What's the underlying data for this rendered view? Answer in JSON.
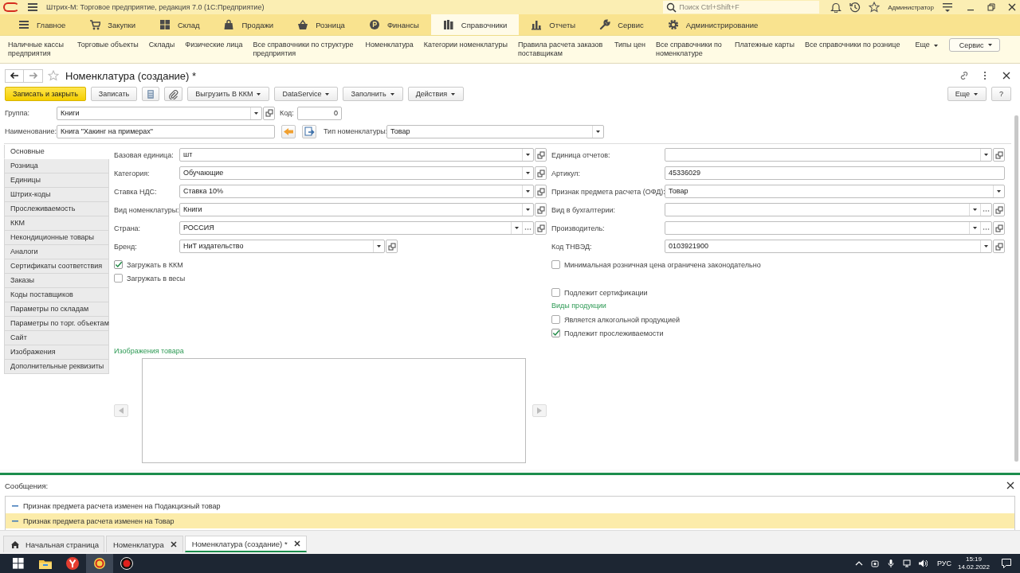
{
  "app": {
    "title": "Штрих-М: Торговое предприятие, редакция 7.0  (1С:Предприятие)",
    "search": {
      "placeholder": "Поиск Ctrl+Shift+F"
    },
    "user": "Администратор"
  },
  "sections": [
    {
      "label": "Главное",
      "kind": "main",
      "selected": false
    },
    {
      "label": "Закупки",
      "kind": "cart",
      "selected": false
    },
    {
      "label": "Склад",
      "kind": "grid",
      "selected": false
    },
    {
      "label": "Продажи",
      "kind": "bag",
      "selected": false
    },
    {
      "label": "Розница",
      "kind": "basket",
      "selected": false
    },
    {
      "label": "Финансы",
      "kind": "coin",
      "selected": false
    },
    {
      "label": "Справочники",
      "kind": "books",
      "selected": true
    },
    {
      "label": "Отчеты",
      "kind": "chart",
      "selected": false
    },
    {
      "label": "Сервис",
      "kind": "wrench",
      "selected": false
    },
    {
      "label": "Администрирование",
      "kind": "gear",
      "selected": false
    }
  ],
  "nav_links": [
    "Наличные кассы предприятия",
    "Торговые объекты",
    "Склады",
    "Физические лица",
    "Все справочники по структуре предприятия",
    "Номенклатура",
    "Категории номенклатуры",
    "Правила расчета заказов поставщикам",
    "Типы цен",
    "Все справочники по номенклатуре",
    "Платежные карты",
    "Все справочники по рознице"
  ],
  "nav_more": "Еще",
  "nav_service": "Сервис",
  "form": {
    "title": "Номенклатура (создание) *",
    "favorite": false,
    "toolbar": [
      {
        "kind": "primary",
        "label": "Записать и закрыть"
      },
      {
        "kind": "plain",
        "label": "Записать"
      },
      {
        "kind": "calculator"
      },
      {
        "kind": "attach"
      },
      {
        "kind": "menu",
        "label": "Выгрузить В ККМ"
      },
      {
        "kind": "menu",
        "label": "DataService"
      },
      {
        "kind": "menu",
        "label": "Заполнить"
      },
      {
        "kind": "menu",
        "label": "Действия"
      }
    ],
    "toolbar_right": [
      {
        "kind": "menu",
        "label": "Еще"
      },
      {
        "kind": "plain",
        "label": "?"
      }
    ],
    "group": {
      "label": "Группа:",
      "value": "Книги",
      "dropdown": true,
      "open": true
    },
    "code": {
      "label": "Код:",
      "value": "0"
    },
    "name": {
      "label": "Наименование:",
      "value": "Книга \"Хакинг на примерах\""
    },
    "item_type": {
      "label": "Тип номенклатуры:",
      "value": "Товар",
      "dropdown": true
    },
    "tabs": [
      {
        "label": "Основные",
        "selected": true
      },
      {
        "label": "Розница",
        "selected": false
      },
      {
        "label": "Единицы",
        "selected": false
      },
      {
        "label": "Штрих-коды",
        "selected": false
      },
      {
        "label": "Прослеживаемость",
        "selected": false
      },
      {
        "label": "ККМ",
        "selected": false
      },
      {
        "label": "Некондиционные товары",
        "selected": false
      },
      {
        "label": "Аналоги",
        "selected": false
      },
      {
        "label": "Сертификаты соответствия",
        "selected": false
      },
      {
        "label": "Заказы",
        "selected": false
      },
      {
        "label": "Коды поставщиков",
        "selected": false
      },
      {
        "label": "Параметры по складам",
        "selected": false
      },
      {
        "label": "Параметры по торг. объектам",
        "selected": false
      },
      {
        "label": "Сайт",
        "selected": false
      },
      {
        "label": "Изображения",
        "selected": false
      },
      {
        "label": "Дополнительные реквизиты",
        "selected": false
      }
    ],
    "left_fields": [
      {
        "label": "Базовая единица:",
        "value": "шт",
        "dropdown": true,
        "open": true
      },
      {
        "label": "Категория:",
        "value": "Обучающие",
        "dropdown": true,
        "open": true
      },
      {
        "label": "Ставка НДС:",
        "value": "Ставка 10%",
        "dropdown": true,
        "open": true
      },
      {
        "label": "Вид номенклатуры:",
        "value": "Книги",
        "dropdown": true,
        "open": true
      },
      {
        "label": "Страна:",
        "value": "РОССИЯ",
        "dropdown": true,
        "choose": true,
        "open": true
      },
      {
        "label": "Бренд:",
        "value": "НиТ издательство",
        "dropdown": true,
        "open": true
      }
    ],
    "left_checks": [
      {
        "label": "Загружать в ККМ",
        "checked": true
      },
      {
        "label": "Загружать в весы",
        "checked": false
      }
    ],
    "right_fields": [
      {
        "label": "Единица отчетов:",
        "dropdown": true,
        "open": true
      },
      {
        "label": "Артикул:",
        "value": "45336029"
      },
      {
        "label": "Признак предмета расчета (ОФД):",
        "value": "Товар",
        "dropdown": true
      },
      {
        "label": "Вид в бухгалтерии:",
        "dropdown": true,
        "choose": true,
        "open": true
      },
      {
        "label": "Производитель:",
        "dropdown": true,
        "choose": true,
        "open": true
      },
      {
        "label": "Код ТНВЭД:",
        "value": "0103921900",
        "dropdown": true,
        "open": true
      }
    ],
    "right_options": [
      {
        "kind": "check",
        "label": "Минимальная розничная цена ограничена законодательно",
        "checked": false
      },
      {
        "kind": "check",
        "label": "Подлежит сертификации",
        "checked": false
      },
      {
        "kind": "heading",
        "label": "Виды продукции"
      },
      {
        "kind": "check",
        "label": "Является алкогольной продукцией",
        "checked": false
      },
      {
        "kind": "check",
        "label": "Подлежит прослеживаемости",
        "checked": true
      }
    ],
    "images": {
      "title": "Изображения товара"
    }
  },
  "messages": {
    "title": "Сообщения:",
    "items": [
      {
        "text": "Признак предмета расчета изменен на Подакцизный товар",
        "selected": false
      },
      {
        "text": "Признак предмета расчета изменен на Товар",
        "selected": true
      }
    ]
  },
  "windows": [
    {
      "kind": "home",
      "label": "Начальная страница",
      "selected": false
    },
    {
      "kind": "doc",
      "label": "Номенклатура",
      "selected": false
    },
    {
      "kind": "doc",
      "label": "Номенклатура (создание) *",
      "selected": true
    }
  ],
  "taskbar": {
    "apps": [
      {
        "kind": "explorer",
        "selected": false
      },
      {
        "kind": "browser",
        "selected": false
      },
      {
        "kind": "onec",
        "selected": true
      },
      {
        "kind": "recorder",
        "selected": false
      }
    ],
    "language": "РУС",
    "time": "15:19",
    "date": "14.02.2022"
  }
}
